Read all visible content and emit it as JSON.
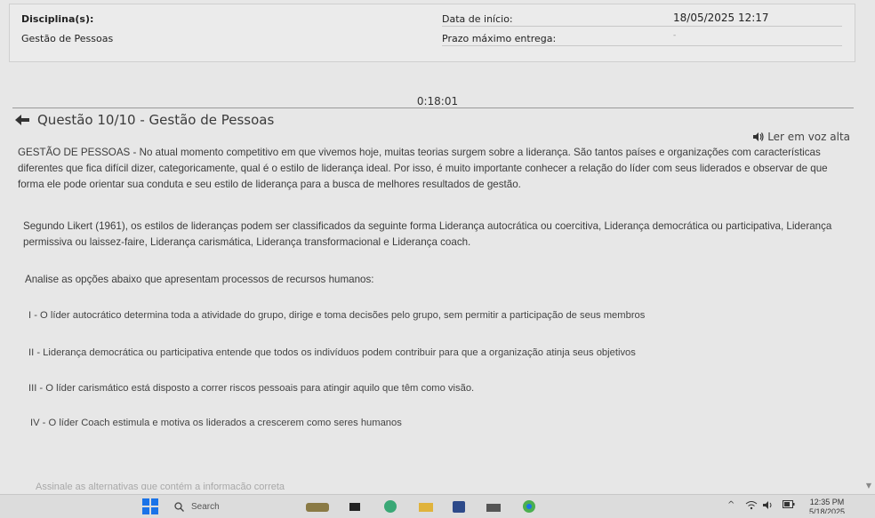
{
  "header": {
    "discipline_label": "Disciplina(s):",
    "discipline_value": "Gestão de Pessoas",
    "start_label": "Data de início:",
    "start_value": "18/05/2025 12:17",
    "deadline_label": "Prazo máximo entrega:",
    "deadline_value": "-"
  },
  "timer": "0:18:01",
  "question": {
    "title": "Questão 10/10 - Gestão de Pessoas",
    "read_aloud": "Ler em voz alta",
    "paragraphs": [
      "GESTÃO DE PESSOAS - No atual momento competitivo em que vivemos hoje, muitas teorias surgem sobre a liderança. São tantos países e organizações com características diferentes que fica difícil dizer, categoricamente, qual é o estilo de liderança ideal. Por isso, é muito importante conhecer a relação do líder com seus liderados e observar de que forma ele pode orientar sua conduta e seu estilo de liderança para a busca de melhores resultados de gestão.",
      "Segundo Likert (1961), os estilos de lideranças podem ser classificados da seguinte forma Liderança autocrática ou coercitiva, Liderança democrática ou participativa, Liderança permissiva ou laissez-faire, Liderança carismática, Liderança transformacional e Liderança coach.",
      "Analise as opções abaixo que apresentam processos de recursos humanos:"
    ],
    "options": [
      "I - O líder autocrático determina toda a atividade do grupo, dirige e toma decisões pelo grupo, sem permitir a participação de seus membros",
      "II - Liderança democrática ou participativa entende que todos os indivíduos podem contribuir para que a organização atinja seus objetivos",
      "III - O líder carismático está disposto a correr riscos pessoais para atingir aquilo que têm como visão.",
      "IV - O líder Coach estimula e motiva os liderados a crescerem como seres humanos"
    ],
    "instruction": "Assinale as alternativas que contém a informação correta"
  },
  "taskbar": {
    "search_placeholder": "Search",
    "time": "12:35 PM",
    "date": "5/18/2025"
  },
  "colors": {
    "background": "#e7e7e7",
    "taskbar": "#dcdcdc",
    "windows_blue": "#1a73e8"
  }
}
